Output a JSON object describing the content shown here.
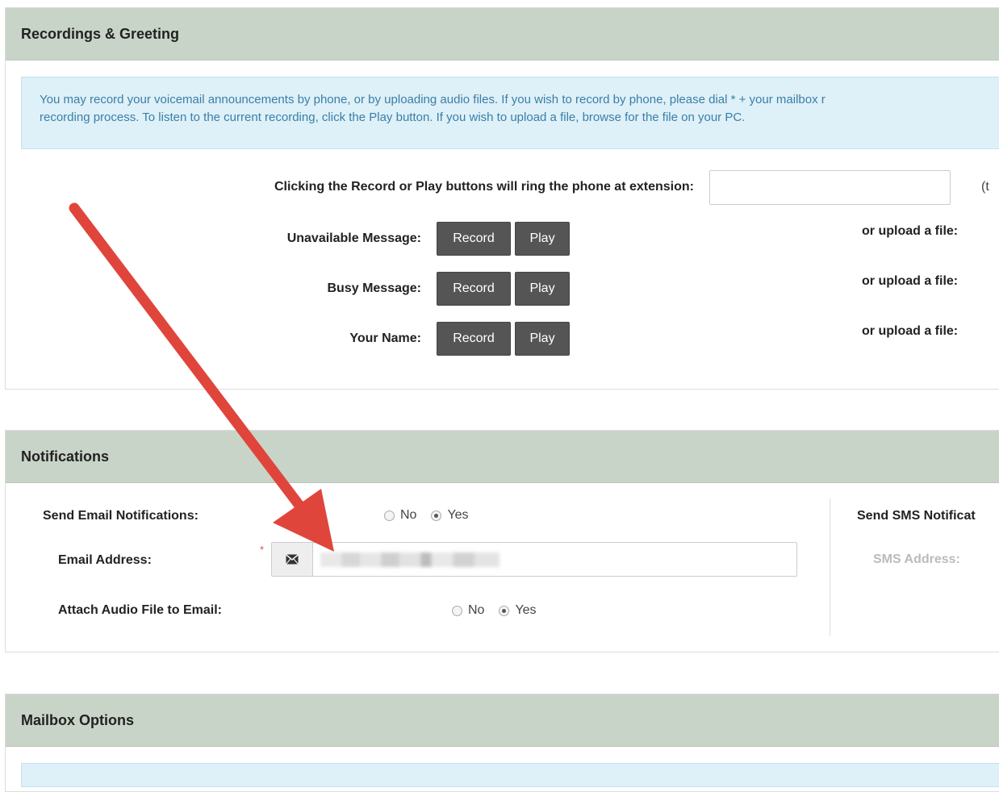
{
  "recordings": {
    "title": "Recordings & Greeting",
    "info_line1": "You may record your voicemail announcements by phone, or by uploading audio files. If you wish to record by phone, please dial * + your mailbox r",
    "info_line2": "recording process. To listen to the current recording, click the Play button. If you wish to upload a file, browse for the file on your PC.",
    "extension_label": "Clicking the Record or Play buttons will ring the phone at extension:",
    "extension_value": "",
    "extension_suffix": "(t",
    "rows": [
      {
        "label": "Unavailable Message:",
        "record": "Record",
        "play": "Play",
        "upload": "or upload a file:"
      },
      {
        "label": "Busy Message:",
        "record": "Record",
        "play": "Play",
        "upload": "or upload a file:"
      },
      {
        "label": "Your Name:",
        "record": "Record",
        "play": "Play",
        "upload": "or upload a file:"
      }
    ]
  },
  "notifications": {
    "title": "Notifications",
    "send_email_label": "Send Email Notifications:",
    "send_email_no": "No",
    "send_email_yes": "Yes",
    "send_email_selected": "Yes",
    "email_label": "Email Address:",
    "required_mark": "*",
    "attach_label": "Attach Audio File to Email:",
    "attach_no": "No",
    "attach_yes": "Yes",
    "attach_selected": "Yes",
    "send_sms_label": "Send SMS Notificat",
    "sms_label": "SMS Address:"
  },
  "mailbox": {
    "title": "Mailbox Options"
  },
  "colors": {
    "header_bg": "#c9d4c8",
    "info_bg": "#def0f8",
    "info_text": "#3a7fa6",
    "button_bg": "#555555",
    "arrow": "#e0453c"
  },
  "icons": {
    "email_addon": "envelope-icon"
  }
}
